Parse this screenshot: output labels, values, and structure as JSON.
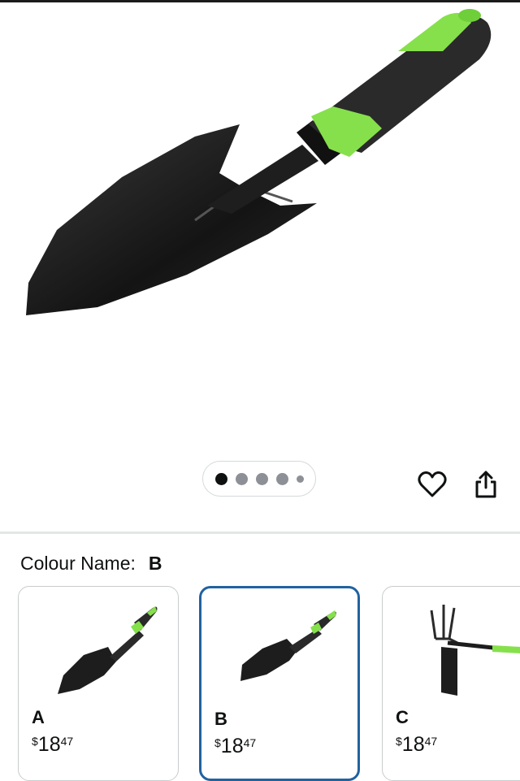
{
  "product": {
    "image_alt": "garden trowel with green grip",
    "gallery": {
      "count": 5,
      "active_index": 0
    }
  },
  "actions": {
    "wishlist_icon": "heart-icon",
    "share_icon": "share-icon"
  },
  "variation": {
    "label": "Colour Name:",
    "selected": "B",
    "options": [
      {
        "name": "A",
        "currency": "$",
        "whole": "18",
        "fraction": "47"
      },
      {
        "name": "B",
        "currency": "$",
        "whole": "18",
        "fraction": "47"
      },
      {
        "name": "C",
        "currency": "$",
        "whole": "18",
        "fraction": "47"
      }
    ]
  },
  "colors": {
    "accent_green": "#8ee04a",
    "selected_border": "#2162a1"
  }
}
